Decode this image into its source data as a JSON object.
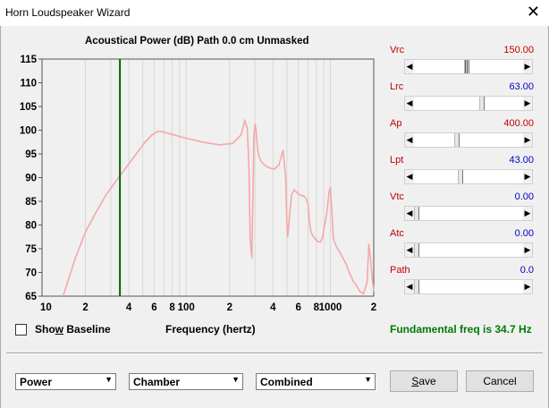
{
  "window": {
    "title": "Horn Loudspeaker Wizard"
  },
  "chart": {
    "title": "Acoustical Power (dB)   Path 0.0 cm   Unmasked"
  },
  "sliders": [
    {
      "label": "Vrc",
      "value": "150.00",
      "value_color": "#c00000",
      "position": 0.48,
      "hatched": true
    },
    {
      "label": "Lrc",
      "value": "63.00",
      "value_color": "#0000c8",
      "position": 0.63
    },
    {
      "label": "Ap",
      "value": "400.00",
      "value_color": "#c00000",
      "position": 0.39
    },
    {
      "label": "Lpt",
      "value": "43.00",
      "value_color": "#0000c8",
      "position": 0.42
    },
    {
      "label": "Vtc",
      "value": "0.00",
      "value_color": "#0000c8",
      "position": 0.0
    },
    {
      "label": "Atc",
      "value": "0.00",
      "value_color": "#0000c8",
      "position": 0.0
    },
    {
      "label": "Path",
      "value": "0.0",
      "value_color": "#0000c8",
      "position": 0.0
    }
  ],
  "show_baseline": {
    "label": "Show Baseline",
    "checked": false
  },
  "xaxis_label": "Frequency (hertz)",
  "fundamental": "Fundamental freq is 34.7 Hz",
  "dropdowns": [
    {
      "value": "Power"
    },
    {
      "value": "Chamber"
    },
    {
      "value": "Combined"
    }
  ],
  "buttons": {
    "save": "Save",
    "cancel": "Cancel"
  },
  "chart_data": {
    "type": "line",
    "title": "Acoustical Power (dB)   Path 0.0 cm   Unmasked",
    "xlabel": "Frequency (hertz)",
    "ylabel": "",
    "xscale": "log",
    "xlim": [
      10,
      2000
    ],
    "ylim": [
      65,
      115
    ],
    "yticks": [
      "115",
      "110",
      "105",
      "100",
      "95",
      "90",
      "85",
      "80",
      "75",
      "70",
      "65"
    ],
    "xticks": [
      "10",
      "2",
      "4",
      "6",
      "8",
      "100",
      "2",
      "4",
      "6",
      "8",
      "1000",
      "2"
    ],
    "marker_line_freq": 34.7,
    "marker_color": "#006400",
    "series_color": "#f4a8a8",
    "grid": true,
    "series": [
      {
        "x": [
          14,
          17,
          20,
          24,
          28,
          33,
          38,
          45,
          52,
          58,
          64,
          70,
          80,
          100,
          130,
          170,
          210,
          240,
          255,
          265,
          272,
          278,
          285,
          290,
          295,
          300,
          305,
          313,
          320,
          330,
          345,
          360,
          380,
          410,
          440,
          470,
          490,
          500,
          505,
          510,
          520,
          540,
          560,
          580,
          600,
          620,
          640,
          660,
          680,
          700,
          710,
          720,
          730,
          740,
          760,
          790,
          820,
          850,
          880,
          900,
          920,
          950,
          980,
          1000,
          1050,
          1100,
          1150,
          1200,
          1250,
          1300,
          1350,
          1400,
          1450,
          1500,
          1600,
          1700,
          1800,
          1850,
          1900,
          1950,
          2000
        ],
        "y": [
          65,
          73,
          78.5,
          83,
          86.5,
          89.5,
          92,
          95,
          97.5,
          99,
          99.8,
          99.6,
          99.1,
          98.3,
          97.5,
          96.9,
          97.2,
          99,
          102,
          100.5,
          93,
          77,
          73,
          85,
          99,
          101.3,
          100,
          96,
          94.5,
          93.5,
          92.8,
          92.4,
          92,
          91.8,
          92.7,
          95.8,
          90,
          80,
          77.5,
          78.5,
          82,
          86.5,
          87.4,
          87,
          86.5,
          86.3,
          86.2,
          86,
          85.5,
          84.5,
          82,
          80,
          79,
          78.3,
          77.6,
          77,
          76.5,
          76.4,
          77.2,
          79,
          80.5,
          83,
          87,
          88,
          77,
          75.5,
          74.5,
          73.5,
          72.5,
          71.5,
          70,
          69,
          68,
          67.5,
          66,
          65.5,
          68,
          76,
          73,
          69,
          66
        ]
      }
    ]
  }
}
